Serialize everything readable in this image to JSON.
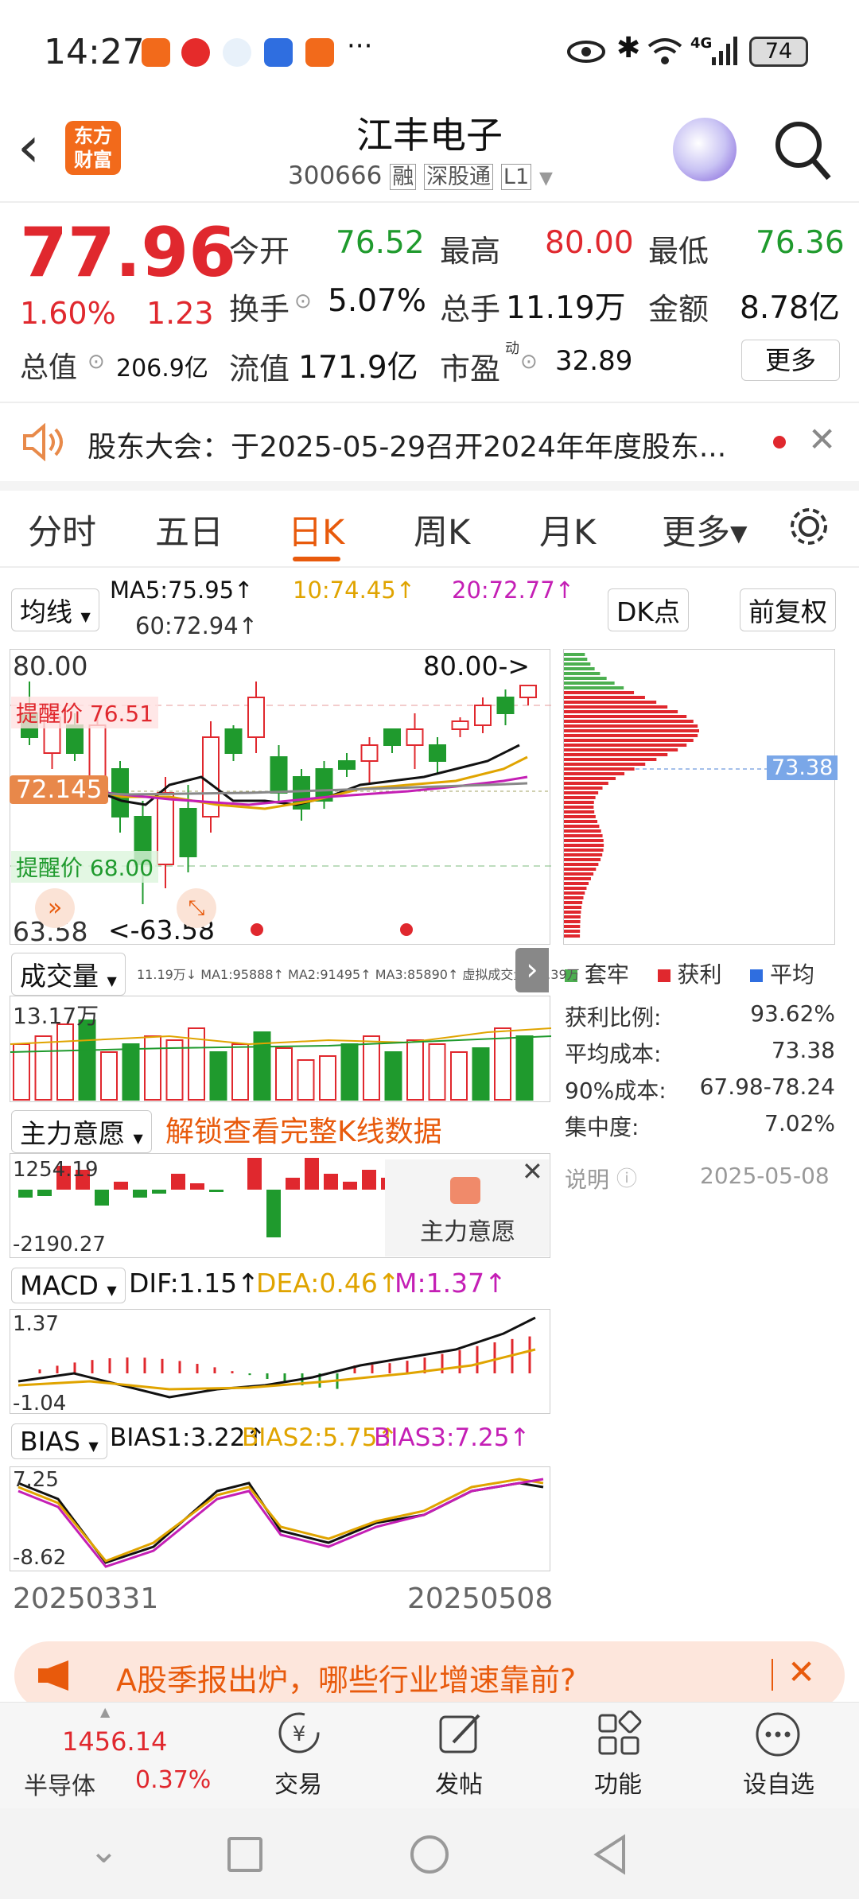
{
  "status": {
    "time": "14:27",
    "battery": "74",
    "net": "4G"
  },
  "header": {
    "back": "‹",
    "logo_line1": "东方",
    "logo_line2": "财富",
    "name": "江丰电子",
    "code": "300666",
    "tags": [
      "融",
      "深股通",
      "L1"
    ]
  },
  "quote": {
    "price": "77.96",
    "pct": "1.60%",
    "chg": "1.23",
    "open_label": "今开",
    "open": "76.52",
    "high_label": "最高",
    "high": "80.00",
    "low_label": "最低",
    "low": "76.36",
    "turnover_label": "换手",
    "turnover": "5.07%",
    "vol_label": "总手",
    "vol": "11.19万",
    "amt_label": "金额",
    "amt": "8.78亿",
    "mcap_label": "总值",
    "mcap": "206.9亿",
    "float_label": "流值",
    "float": "171.9亿",
    "pe_label": "市盈",
    "pe_sup": "动",
    "pe": "32.89",
    "more": "更多"
  },
  "notice": {
    "text": "股东大会：于2025-05-29召开2024年年度股东..."
  },
  "tabs": [
    "分时",
    "五日",
    "日K",
    "周K",
    "月K",
    "更多▾"
  ],
  "kline": {
    "indicator": "均线",
    "ma5": "MA5:75.95↑",
    "ma10": "10:74.45↑",
    "ma20": "20:72.77↑",
    "ma60": "60:72.94↑",
    "dk": "DK点",
    "fq": "前复权",
    "top": "80.00",
    "bottom": "63.58",
    "hi_mark": "80.00->",
    "lo_mark": "<-63.58",
    "cur_label": "72.145",
    "alert1": "提醒价 76.51",
    "alert2": "提醒价 68.00",
    "date_start": "20250331",
    "date_end": "20250508"
  },
  "chip": {
    "avg_tag": "73.38",
    "legend": [
      "套牢",
      "获利",
      "平均"
    ],
    "rows": [
      {
        "k": "获利比例:",
        "v": "93.62%"
      },
      {
        "k": "平均成本:",
        "v": "73.38"
      },
      {
        "k": "90%成本:",
        "v": "67.98-78.24"
      },
      {
        "k": "集中度:",
        "v": "7.02%"
      }
    ],
    "note": "说明",
    "date": "2025-05-08"
  },
  "volume": {
    "label": "成交量",
    "info": "11.19万↓ MA1:95888↑ MA2:91495↑ MA3:85890↑ 虚拟成交量:12.39万",
    "top": "13.17万"
  },
  "main": {
    "label": "主力意愿",
    "unlock": "解锁查看完整K线数据",
    "top": "1254.19",
    "bottom": "-2190.27",
    "popup": "主力意愿"
  },
  "macd": {
    "label": "MACD",
    "dif": "DIF:1.15↑",
    "dea": "DEA:0.46↑",
    "m": "M:1.37↑",
    "top": "1.37",
    "bottom": "-1.04"
  },
  "bias": {
    "label": "BIAS",
    "b1": "BIAS1:3.22↑",
    "b2": "BIAS2:5.75↑",
    "b3": "BIAS3:7.25↑",
    "top": "7.25",
    "bottom": "-8.62"
  },
  "banner": {
    "text": "A股季报出炉，哪些行业增速靠前?"
  },
  "bottom": {
    "index_val": "1456.14",
    "index_name": "半导体",
    "index_pct": "0.37%",
    "items": [
      "交易",
      "发帖",
      "功能",
      "设自选"
    ]
  },
  "colors": {
    "up": "#e0282e",
    "down": "#1f9a2d",
    "accent": "#e85a0c"
  }
}
